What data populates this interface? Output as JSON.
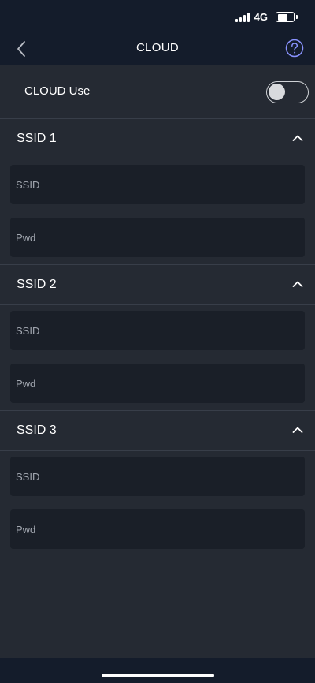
{
  "status_bar": {
    "network": "4G",
    "battery_level": 0.75,
    "signal_bars": 4
  },
  "nav": {
    "title": "CLOUD",
    "back_icon": "chevron-left-icon",
    "help_icon": "question-circle-icon",
    "accent_color": "#8a93ff"
  },
  "cloud_use": {
    "label": "CLOUD Use",
    "enabled": false
  },
  "sections": [
    {
      "title": "SSID 1",
      "expanded": true,
      "ssid": {
        "value": "",
        "placeholder": "SSID"
      },
      "pwd": {
        "value": "",
        "placeholder": "Pwd"
      }
    },
    {
      "title": "SSID 2",
      "expanded": true,
      "ssid": {
        "value": "",
        "placeholder": "SSID"
      },
      "pwd": {
        "value": "",
        "placeholder": "Pwd"
      }
    },
    {
      "title": "SSID 3",
      "expanded": true,
      "ssid": {
        "value": "",
        "placeholder": "SSID"
      },
      "pwd": {
        "value": "",
        "placeholder": "Pwd"
      }
    }
  ],
  "colors": {
    "background": "#252a33",
    "header": "#141c2b",
    "field": "#1a1f28",
    "text": "#ffffff",
    "placeholder": "#a2a7b0"
  }
}
